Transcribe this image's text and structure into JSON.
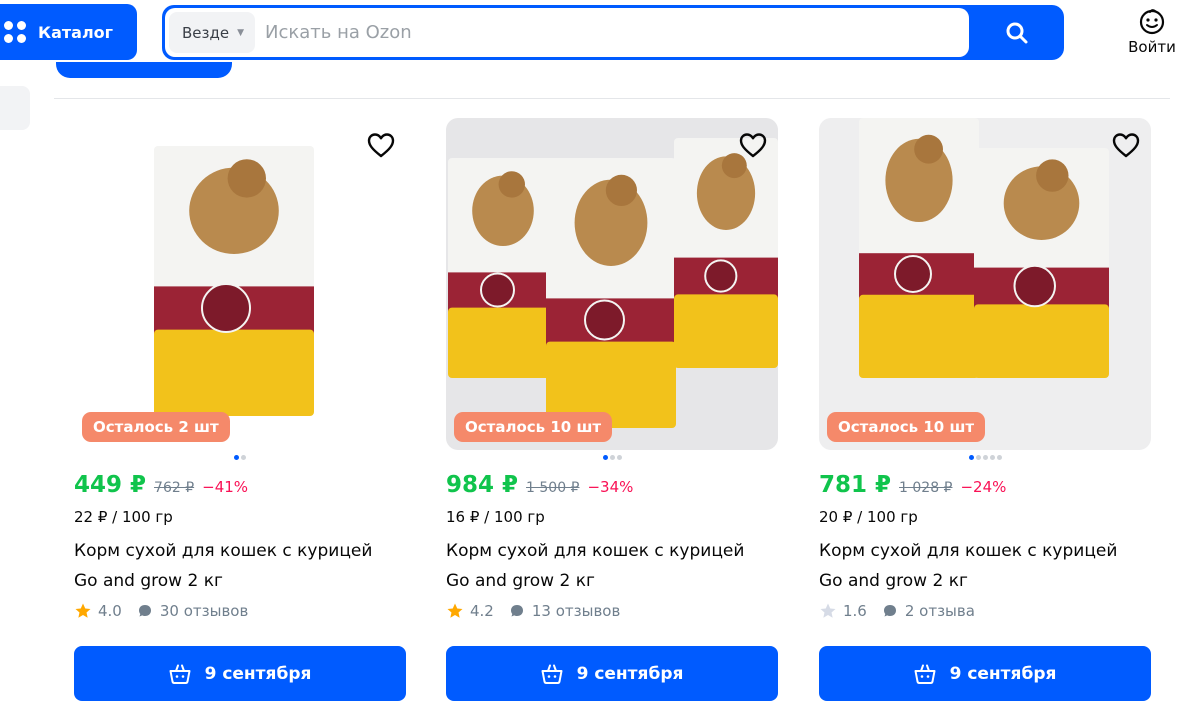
{
  "header": {
    "catalog_label": "Каталог",
    "search": {
      "scope": "Везде",
      "placeholder": "Искать на Ozon",
      "value": ""
    },
    "login_label": "Войти"
  },
  "products": [
    {
      "stock_badge": "Осталось 2 шт",
      "price": "449 ₽",
      "old_price": "762 ₽",
      "discount": "−41%",
      "unit_price": "22 ₽ / 100 гр",
      "title_line1": "Корм сухой для кошек с курицей",
      "title_line2": "Go and grow 2 кг",
      "rating": "4.0",
      "reviews": "30 отзывов",
      "delivery": "9 сентября",
      "image_dots": 2,
      "image_active": 0,
      "star_color": "#ffa800"
    },
    {
      "stock_badge": "Осталось 10 шт",
      "price": "984 ₽",
      "old_price": "1 500 ₽",
      "discount": "−34%",
      "unit_price": "16 ₽ / 100 гр",
      "title_line1": "Корм сухой для кошек с курицей",
      "title_line2": "Go and grow 2 кг",
      "rating": "4.2",
      "reviews": "13 отзывов",
      "delivery": "9 сентября",
      "image_dots": 3,
      "image_active": 0,
      "star_color": "#ffa800"
    },
    {
      "stock_badge": "Осталось 10 шт",
      "price": "781 ₽",
      "old_price": "1 028 ₽",
      "discount": "−24%",
      "unit_price": "20 ₽ / 100 гр",
      "title_line1": "Корм сухой для кошек с курицей",
      "title_line2": "Go and grow 2 кг",
      "rating": "1.6",
      "reviews": "2 отзыва",
      "delivery": "9 сентября",
      "image_dots": 5,
      "image_active": 0,
      "star_color": "#d6dbe6"
    }
  ],
  "colors": {
    "brand": "#005bff",
    "price": "#10c44c",
    "discount": "#f91155",
    "stock_badge": "#f5896a"
  },
  "icons": [
    "grid-icon",
    "chevron-down-icon",
    "search-icon",
    "smiley-face-icon",
    "heart-icon",
    "star-icon",
    "chat-bubble-icon",
    "basket-icon"
  ]
}
